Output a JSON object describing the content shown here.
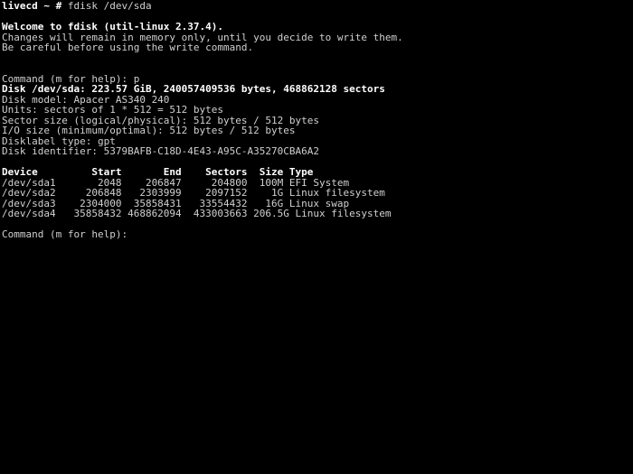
{
  "terminal": {
    "window_title": "fdisk /dev/sda",
    "background_color": "#000000",
    "foreground_color": "#c8c8c8",
    "colors": {
      "red": "#cc0000",
      "magenta": "#a020b0",
      "blue": "#3333dd",
      "green": "#00cc00",
      "white": "#d0d0d0",
      "bright_white": "#ffffff"
    },
    "prompt": {
      "host": "livecd",
      "path": "~",
      "symbol": "#",
      "command": "fdisk /dev/sda"
    },
    "welcome": "Welcome to fdisk (util-linux 2.37.4).",
    "notice_line_1": "Changes will remain in memory only, until you decide to write them.",
    "notice_line_2": "Be careful before using the write command.",
    "command_prompt_1": "Command (m for help): ",
    "command_entered_1": "p",
    "disk_info": {
      "disk_line": "Disk /dev/sda: 223.57 GiB, 240057409536 bytes, 468862128 sectors",
      "model": "Disk model: Apacer AS340 240",
      "units": "Units: sectors of 1 * 512 = 512 bytes",
      "sector_size": "Sector size (logical/physical): 512 bytes / 512 bytes",
      "io_size": "I/O size (minimum/optimal): 512 bytes / 512 bytes",
      "disklabel_type": "Disklabel type: gpt",
      "disk_identifier": "Disk identifier: 5379BAFB-C18D-4E43-A95C-A35270CBA6A2"
    },
    "partition_table": {
      "headers": {
        "device": "Device",
        "start": "Start",
        "end": "End",
        "sectors": "Sectors",
        "size": "Size",
        "type": "Type"
      },
      "header_line": "Device         Start       End    Sectors  Size Type",
      "rows": [
        {
          "device": "/dev/sda1",
          "start": "2048",
          "end": "206847",
          "sectors": "204800",
          "size": "100M",
          "type": "EFI System",
          "line": "/dev/sda1       2048    206847     204800  100M EFI System"
        },
        {
          "device": "/dev/sda2",
          "start": "206848",
          "end": "2303999",
          "sectors": "2097152",
          "size": "1G",
          "type": "Linux filesystem",
          "line": "/dev/sda2     206848   2303999    2097152    1G Linux filesystem"
        },
        {
          "device": "/dev/sda3",
          "start": "2304000",
          "end": "35858431",
          "sectors": "33554432",
          "size": "16G",
          "type": "Linux swap",
          "line": "/dev/sda3    2304000  35858431   33554432   16G Linux swap"
        },
        {
          "device": "/dev/sda4",
          "start": "35858432",
          "end": "468862094",
          "sectors": "433003663",
          "size": "206.5G",
          "type": "Linux filesystem",
          "line": "/dev/sda4   35858432 468862094  433003663 206.5G Linux filesystem"
        }
      ]
    },
    "command_prompt_2": "Command (m for help): "
  }
}
